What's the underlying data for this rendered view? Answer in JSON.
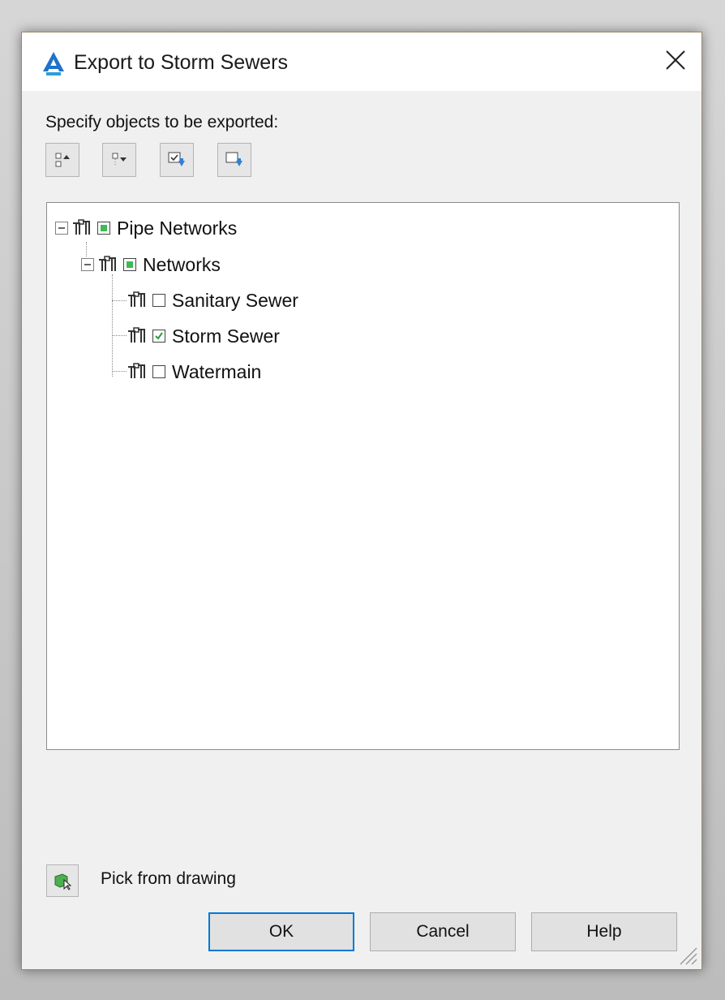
{
  "dialog": {
    "title": "Export to Storm Sewers",
    "close_icon": "close-icon",
    "app_icon": "autocad-civil-icon"
  },
  "instructions": "Specify objects to be exported:",
  "toolbar": [
    {
      "name": "collapse-all-button",
      "icon": "collapse-tree-icon"
    },
    {
      "name": "expand-all-button",
      "icon": "expand-tree-icon"
    },
    {
      "name": "select-all-button",
      "icon": "check-all-icon"
    },
    {
      "name": "clear-all-button",
      "icon": "uncheck-all-icon"
    }
  ],
  "tree": {
    "root": {
      "label": "Pipe Networks",
      "expanded": true,
      "state": "partial"
    },
    "group": {
      "label": "Networks",
      "expanded": true,
      "state": "partial"
    },
    "items": [
      {
        "label": "Sanitary Sewer",
        "checked": false
      },
      {
        "label": "Storm Sewer",
        "checked": true
      },
      {
        "label": "Watermain",
        "checked": false
      }
    ]
  },
  "pick": {
    "label": "Pick from drawing",
    "icon": "pick-from-drawing-icon"
  },
  "buttons": {
    "ok": "OK",
    "cancel": "Cancel",
    "help": "Help"
  },
  "colors": {
    "accent": "#0078d7",
    "check_green": "#3dbb55",
    "tile_blue": "#2f7fd6"
  }
}
